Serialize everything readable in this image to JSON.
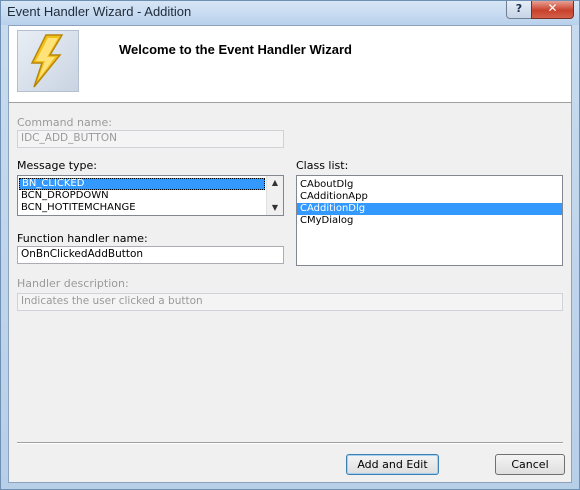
{
  "window": {
    "title": "Event Handler Wizard - Addition",
    "help_glyph": "?",
    "close_glyph": "✕"
  },
  "banner": {
    "heading": "Welcome to the Event Handler Wizard",
    "logo_icon": "lightning-bolt-icon"
  },
  "command": {
    "label": "Command name:",
    "value": "IDC_ADD_BUTTON"
  },
  "message_type": {
    "label": "Message type:",
    "items": [
      "BN_CLICKED",
      "BCN_DROPDOWN",
      "BCN_HOTITEMCHANGE"
    ],
    "selected": "BN_CLICKED"
  },
  "class_list": {
    "label": "Class list:",
    "items": [
      "CAboutDlg",
      "CAdditionApp",
      "CAdditionDlg",
      "CMyDialog"
    ],
    "selected": "CAdditionDlg"
  },
  "function_handler": {
    "label": "Function handler name:",
    "value": "OnBnClickedAddButton"
  },
  "handler_description": {
    "label": "Handler description:",
    "value": "Indicates the user clicked a button"
  },
  "buttons": {
    "add_and_edit": "Add and Edit",
    "cancel": "Cancel"
  },
  "colors": {
    "selection": "#3399ff",
    "bolt": "#f2c21b"
  }
}
